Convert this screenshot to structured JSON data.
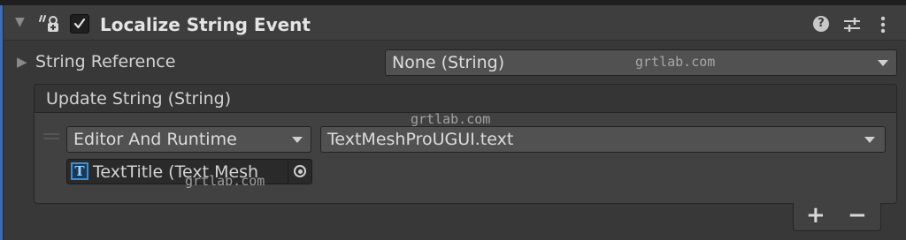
{
  "component": {
    "title": "Localize String Event",
    "enabled": true,
    "icons": {
      "component": "localize-event-icon",
      "help": "help-icon",
      "presets": "presets-icon",
      "menu": "kebab-menu-icon"
    }
  },
  "string_reference": {
    "label": "String Reference",
    "value": "None (String)"
  },
  "update_event": {
    "header": "Update String (String)",
    "listeners": [
      {
        "call_state": "Editor And Runtime",
        "function": "TextMeshProUGUI.text",
        "target": "TextTitle (Text Mesh"
      }
    ],
    "add_label": "+",
    "remove_label": "−"
  },
  "watermark": {
    "text": "grtlab.com"
  },
  "colors": {
    "accent": "#3d6cb5",
    "panel": "#383838",
    "dropdown": "#515151",
    "tmp_icon": "#3b8ed3"
  }
}
